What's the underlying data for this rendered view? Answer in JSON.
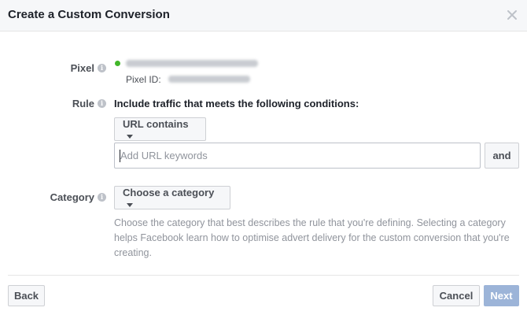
{
  "dialog": {
    "title": "Create a Custom Conversion"
  },
  "pixel": {
    "label": "Pixel",
    "id_label": "Pixel ID:",
    "status_color": "#42b72a"
  },
  "rule": {
    "label": "Rule",
    "heading": "Include traffic that meets the following conditions:",
    "condition_select": "URL contains",
    "url_placeholder": "Add URL keywords",
    "url_value": "",
    "and_label": "and"
  },
  "category": {
    "label": "Category",
    "select_label": "Choose a category",
    "help_text": "Choose the category that best describes the rule that you're defining. Selecting a category helps Facebook learn how to optimise advert delivery for the custom conversion that you're creating."
  },
  "footer": {
    "back_label": "Back",
    "cancel_label": "Cancel",
    "next_label": "Next"
  },
  "icons": {
    "close": "close-icon",
    "info": "info-icon",
    "caret": "caret-down-icon"
  },
  "colors": {
    "primary_disabled": "#9cb4d8",
    "accent_green": "#42b72a"
  }
}
